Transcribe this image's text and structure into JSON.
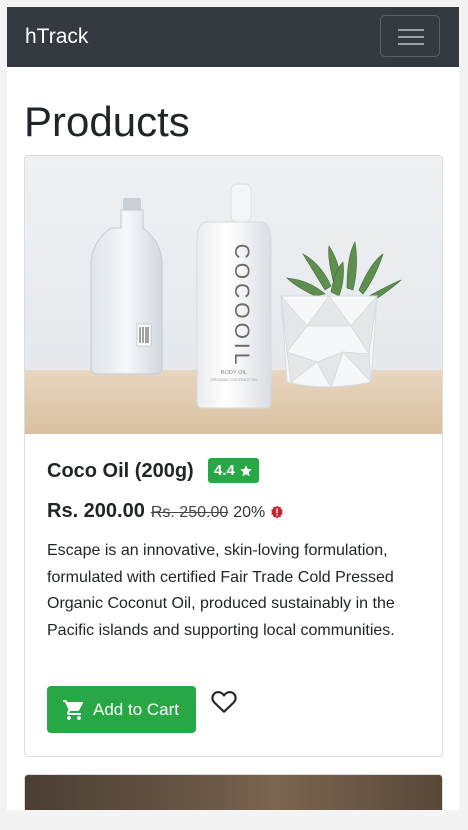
{
  "navbar": {
    "brand": "hTrack",
    "toggle_icon": "hamburger-icon"
  },
  "page": {
    "heading": "Products"
  },
  "products": [
    {
      "image_label": "COCOOIL",
      "image_sub_label": "BODY OIL",
      "image_sub_label2": "ORGANIC COCONUT OIL",
      "title": "Coco Oil (200g)",
      "rating": "4.4",
      "rating_icon": "star-icon",
      "price": "Rs. 200.00",
      "old_price": "Rs. 250.00",
      "discount": "20%",
      "discount_icon": "alert-badge-icon",
      "description": "Escape is an innovative, skin-loving formulation, formulated with certified Fair Trade Cold Pressed Organic Coconut Oil, produced sustainably in the Pacific islands and supporting local communities.",
      "add_to_cart_label": "Add to Cart",
      "cart_icon": "cart-icon",
      "wishlist_icon": "heart-icon"
    }
  ],
  "colors": {
    "navbar_bg": "#343a40",
    "success": "#28a745",
    "discount_icon": "#c82333"
  }
}
